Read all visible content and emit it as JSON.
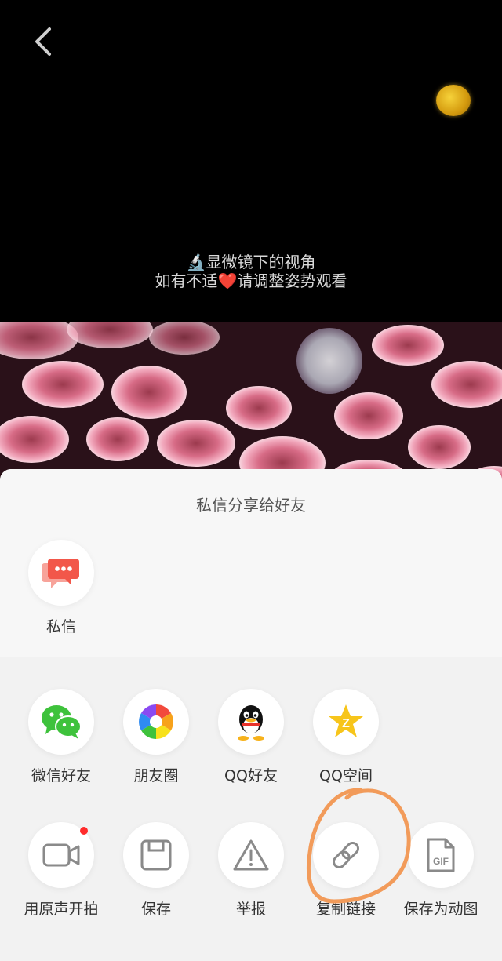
{
  "video": {
    "caption_line1": "🔬显微镜下的视角",
    "caption_line2": "如有不适❤️请调整姿势观看"
  },
  "share_sheet": {
    "title": "私信分享给好友",
    "private_message": {
      "label": "私信",
      "icon": "chat-bubbles-icon"
    },
    "row1": [
      {
        "label": "微信好友",
        "icon": "wechat-icon"
      },
      {
        "label": "朋友圈",
        "icon": "moments-icon"
      },
      {
        "label": "QQ好友",
        "icon": "qq-icon"
      },
      {
        "label": "QQ空间",
        "icon": "qzone-icon"
      }
    ],
    "row2": [
      {
        "label": "用原声开拍",
        "icon": "video-camera-icon"
      },
      {
        "label": "保存",
        "icon": "save-icon"
      },
      {
        "label": "举报",
        "icon": "warning-icon"
      },
      {
        "label": "复制链接",
        "icon": "link-icon"
      },
      {
        "label": "保存为动图",
        "icon": "gif-file-icon"
      }
    ],
    "gif_badge_text": "GIF"
  },
  "colors": {
    "annotation": "#f29b5a",
    "accent_red": "#ff2b2b",
    "wechat_green": "#3ec23c"
  }
}
